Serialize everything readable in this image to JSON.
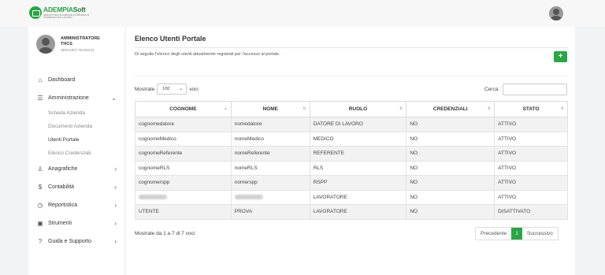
{
  "brand": {
    "name_a": "ADEMPIA",
    "name_b": "Soft",
    "tagline": "SERVIZI PER LE AZIENDE IN MATERIA DI SICUREZZA SUL LAVORO",
    "accent": "#27a745"
  },
  "user": {
    "name": "AMMINISTRATORE THCS",
    "role": "SERVIZIO TECNICO"
  },
  "sidebar": {
    "items": [
      {
        "label": "Dashboard",
        "icon": "home-icon",
        "glyph": "⌂"
      },
      {
        "label": "Amministrazione",
        "icon": "list-icon",
        "glyph": "☰",
        "chevron": "⌄"
      },
      {
        "label": "Anagrafiche",
        "icon": "person-icon",
        "glyph": "♙",
        "chevron": "›"
      },
      {
        "label": "Contabilità",
        "icon": "dollar-icon",
        "glyph": "$",
        "chevron": "›"
      },
      {
        "label": "Reportistica",
        "icon": "clock-icon",
        "glyph": "◷",
        "chevron": "›"
      },
      {
        "label": "Strumenti",
        "icon": "tools-icon",
        "glyph": "▣",
        "chevron": "›"
      },
      {
        "label": "Guida e Supporto",
        "icon": "question-icon",
        "glyph": "?",
        "chevron": "›"
      }
    ],
    "sub_items": [
      "Scheda Azienda",
      "Documenti Azienda",
      "Utenti Portale",
      "Elenco Credenziali"
    ]
  },
  "main": {
    "title": "Elenco Utenti Portale",
    "description": "Di seguito l'elenco degli utenti attualmente registrati per l'accesso al portale.",
    "add_label": "+",
    "show_prefix": "Mostrate",
    "page_size": "100",
    "show_suffix": "voci",
    "search_label": "Cerca:",
    "info": "Mostrate da 1 a 7 di 7 voci",
    "prev": "Precedente",
    "page": "1",
    "next": "Successivo"
  },
  "table": {
    "headers": [
      "COGNOME",
      "NOME",
      "RUOLO",
      "CREDENZIALI",
      "STATO"
    ],
    "rows": [
      [
        "cognomedatore",
        "nomedatore",
        "DATORE DI LAVORO",
        "NO",
        "ATTIVO"
      ],
      [
        "cognomeMedico",
        "nomeMedico",
        "MEDICO",
        "NO",
        "ATTIVO"
      ],
      [
        "cognomeReferente",
        "nomeReferente",
        "REFERENTE",
        "NO",
        "ATTIVO"
      ],
      [
        "cognomeRLS",
        "nomeRLS",
        "RLS",
        "NO",
        "ATTIVO"
      ],
      [
        "cognomerspp",
        "nomerspp",
        "RSPP",
        "NO",
        "ATTIVO"
      ],
      [
        "",
        "",
        "LAVORATORE",
        "NO",
        "ATTIVO"
      ],
      [
        "UTENTE",
        "PROVA",
        "LAVORATORE",
        "NO",
        "DISATTIVATO"
      ]
    ]
  }
}
